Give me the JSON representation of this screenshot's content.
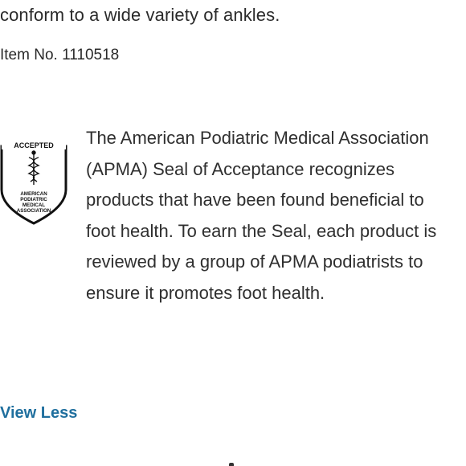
{
  "product": {
    "description_tail": "conform to a wide variety of ankles.",
    "item_number": "Item No. 1110518"
  },
  "apma": {
    "seal_text": {
      "accepted": "ACCEPTED",
      "line1": "AMERICAN",
      "line2": "PODIATRIC",
      "line3": "MEDICAL",
      "line4": "ASSOCIATION"
    },
    "statement": " The American Podiatric Medical Association (APMA) Seal of Acceptance recognizes products that have been found beneficial to foot health. To earn the Seal, each product is reviewed by a group of APMA podiatrists to ensure it promotes foot health."
  },
  "actions": {
    "view_less_label": "View Less"
  },
  "colors": {
    "link": "#1f6f9e",
    "text": "#2f2f2f"
  }
}
